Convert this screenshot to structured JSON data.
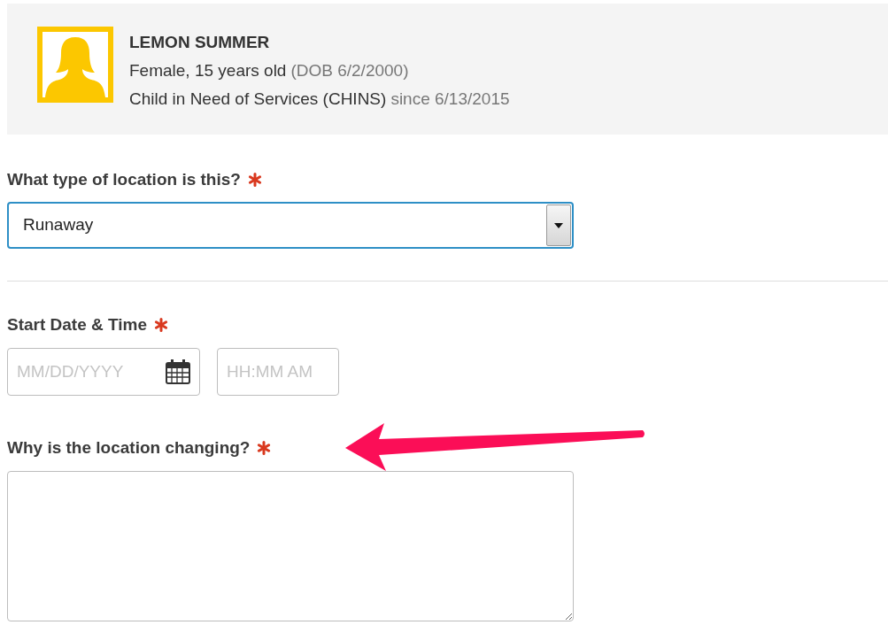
{
  "person": {
    "name": "LEMON SUMMER",
    "details": "Female, 15 years old",
    "dob": "(DOB 6/2/2000)",
    "status": "Child in Need of Services (CHINS)",
    "since": "since 6/13/2015"
  },
  "fields": [
    {
      "kind": "select",
      "label": "What type of location is this?",
      "required": true,
      "value": "Runaway"
    },
    {
      "kind": "datetime",
      "label": "Start Date & Time",
      "required": true,
      "date_placeholder": "MM/DD/YYYY",
      "time_placeholder": "HH:MM AM"
    },
    {
      "kind": "textarea",
      "label": "Why is the location changing?",
      "required": true
    }
  ]
}
